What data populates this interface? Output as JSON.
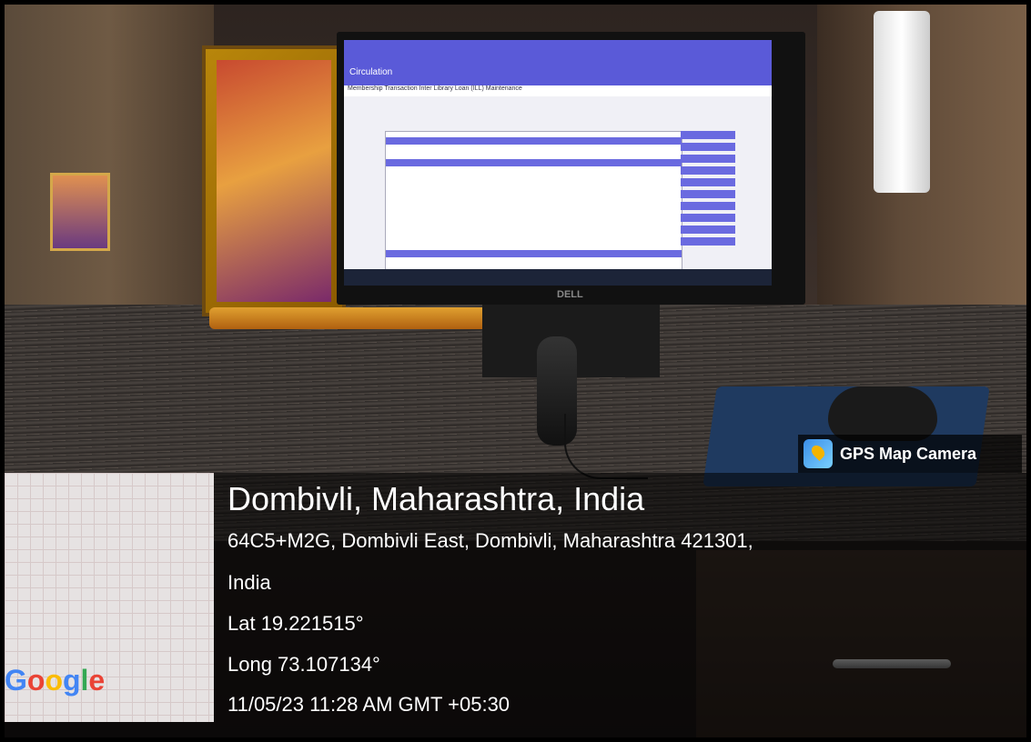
{
  "overlay": {
    "badge_label": "GPS Map Camera",
    "badge_icon": "gps-map-camera-icon",
    "city": "Dombivli, Maharashtra, India",
    "address_line1": "64C5+M2G, Dombivli East, Dombivli, Maharashtra 421301,",
    "address_line2": "India",
    "latitude": "Lat 19.221515°",
    "longitude": "Long 73.107134°",
    "datetime": "11/05/23 11:28 AM GMT +05:30",
    "map_logo": "Google"
  },
  "monitor": {
    "brand": "DELL",
    "app_title": "Circulation",
    "menu": "Membership  Transaction  Inter Library Loan (ILL)  Maintenance"
  },
  "colors": {
    "app_accent": "#5a5ad8",
    "badge_bg": "#000000",
    "text": "#ffffff"
  }
}
